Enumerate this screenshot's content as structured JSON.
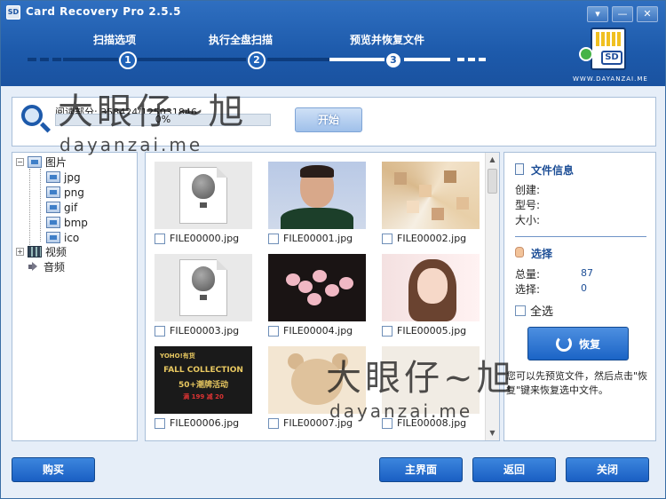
{
  "app": {
    "title": "Card Recovery Pro 2.5.5",
    "icon": "app-icon"
  },
  "window_controls": [
    "▾",
    "—",
    "✕"
  ],
  "steps": [
    {
      "label": "扫描选项",
      "number": "1"
    },
    {
      "label": "执行全盘扫描",
      "number": "2"
    },
    {
      "label": "预览并恢复文件",
      "number": "3"
    }
  ],
  "brand": {
    "card_text": "SD",
    "url": "WWW.DAYANZAI.ME"
  },
  "scan": {
    "read_text": "阅读部分: 358424/125031846",
    "progress_percent": 0,
    "progress_text": "0%",
    "start_label": "开始"
  },
  "tree": [
    {
      "label": "图片",
      "toggle": "−"
    },
    {
      "label": "jpg"
    },
    {
      "label": "png"
    },
    {
      "label": "gif"
    },
    {
      "label": "bmp"
    },
    {
      "label": "ico"
    },
    {
      "label": "视频",
      "toggle": "+"
    },
    {
      "label": "音频"
    }
  ],
  "files": [
    {
      "name": "FILE00000.jpg",
      "thumb": "placeholder"
    },
    {
      "name": "FILE00001.jpg",
      "thumb": "portrait"
    },
    {
      "name": "FILE00002.jpg",
      "thumb": "mosaic"
    },
    {
      "name": "FILE00003.jpg",
      "thumb": "placeholder"
    },
    {
      "name": "FILE00004.jpg",
      "thumb": "blossom"
    },
    {
      "name": "FILE00005.jpg",
      "thumb": "girl"
    },
    {
      "name": "FILE00006.jpg",
      "thumb": "poster"
    },
    {
      "name": "FILE00007.jpg",
      "thumb": "bear"
    },
    {
      "name": "FILE00008.jpg",
      "thumb": "placeholder-light"
    }
  ],
  "poster_text": [
    "YOHO!有货",
    "FALL COLLECTION",
    "50+潮牌活动",
    "满 199 减 20"
  ],
  "info": {
    "file_info_title": "文件信息",
    "created_label": "创建:",
    "type_label": "型号:",
    "size_label": "大小:",
    "select_title": "选择",
    "total_label": "总量:",
    "total_value": "87",
    "selected_label": "选择:",
    "selected_value": "0",
    "select_all_label": "全选",
    "recover_label": "恢复",
    "hint": "您可以先预览文件，然后点击\"恢复\"键来恢复选中文件。"
  },
  "footer": {
    "buy": "购买",
    "main": "主界面",
    "back": "返回",
    "close": "关闭"
  },
  "watermark": {
    "big": "大眼仔~旭",
    "small": "dayanzai.me"
  },
  "colors": {
    "header": "#1d5aab",
    "accent": "#1b64c6",
    "link_blue": "#1d4e96"
  }
}
